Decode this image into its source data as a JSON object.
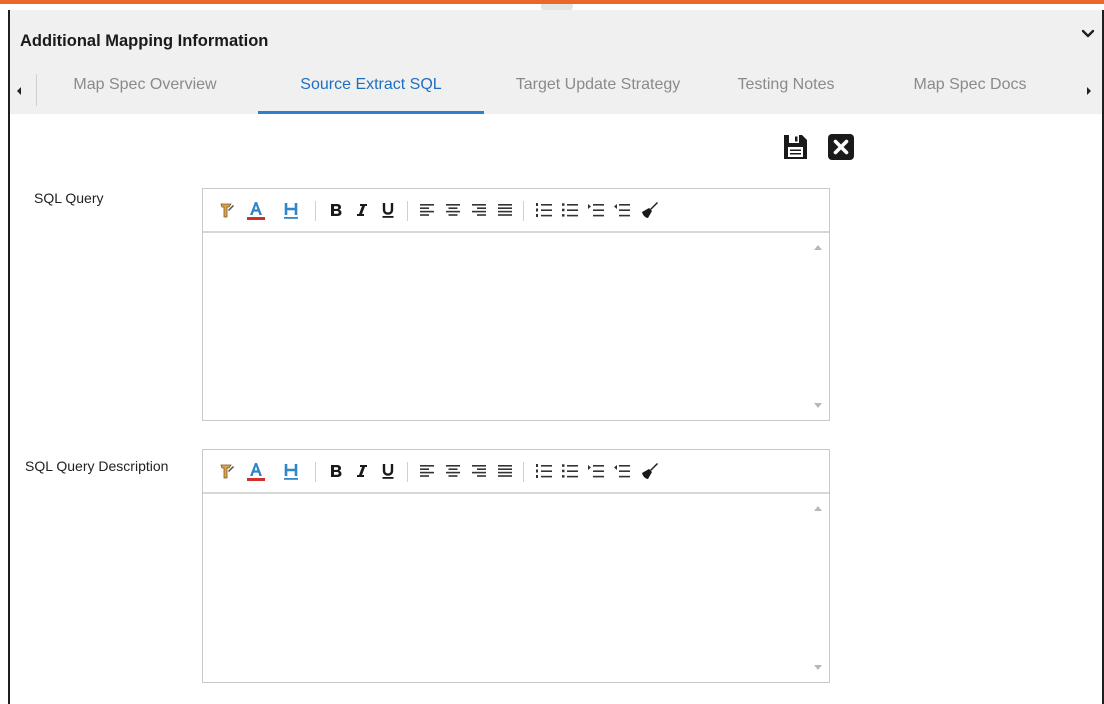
{
  "panel": {
    "title": "Additional Mapping Information"
  },
  "tabs": [
    {
      "label": "Map Spec Overview",
      "active": false
    },
    {
      "label": "Source Extract SQL",
      "active": true
    },
    {
      "label": "Target Update Strategy",
      "active": false
    },
    {
      "label": "Testing Notes",
      "active": false
    },
    {
      "label": "Map Spec Docs",
      "active": false
    }
  ],
  "actions": [
    {
      "icon": "save-icon"
    },
    {
      "icon": "close-icon"
    }
  ],
  "fields": [
    {
      "label": "SQL Query",
      "value": ""
    },
    {
      "label": "SQL Query Description",
      "value": ""
    }
  ],
  "toolbar_icons": [
    "font-icon",
    "text-color-icon",
    "highlight-icon",
    "bold-icon",
    "italic-icon",
    "underline-icon",
    "align-left-icon",
    "align-center-icon",
    "align-right-icon",
    "align-justify-icon",
    "ordered-list-icon",
    "unordered-list-icon",
    "indent-icon",
    "outdent-icon",
    "clear-format-icon"
  ],
  "colors": {
    "accent": "#e8692a",
    "active_tab": "#1f6fbf",
    "text_color_underline": "#d0312d",
    "icon_blue": "#2f86c9"
  }
}
